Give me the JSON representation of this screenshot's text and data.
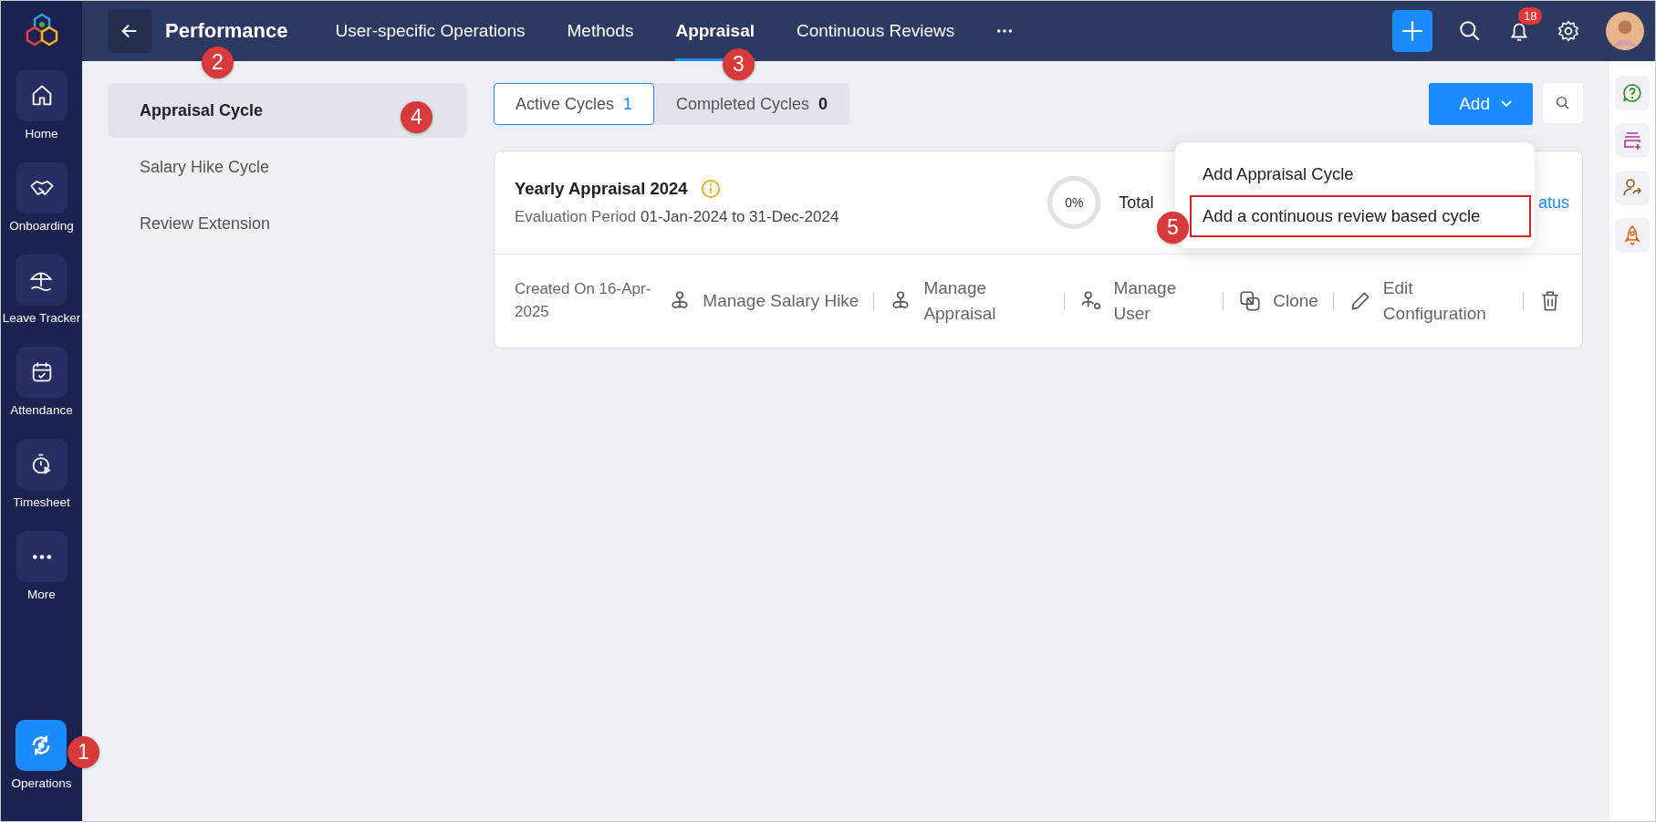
{
  "app_rail": {
    "items": [
      {
        "label": "Home",
        "selected": false
      },
      {
        "label": "Onboarding",
        "selected": false
      },
      {
        "label": "Leave Tracker",
        "selected": false
      },
      {
        "label": "Attendance",
        "selected": false
      },
      {
        "label": "Timesheet",
        "selected": false
      },
      {
        "label": "More",
        "selected": false
      }
    ],
    "bottom_item": {
      "label": "Operations",
      "selected": true
    }
  },
  "top_bar": {
    "title": "Performance",
    "nav": [
      {
        "label": "User-specific Operations",
        "selected": false
      },
      {
        "label": "Methods",
        "selected": false
      },
      {
        "label": "Appraisal",
        "selected": true
      },
      {
        "label": "Continuous Reviews",
        "selected": false
      }
    ],
    "notification_count": "18"
  },
  "sub_sidebar": {
    "items": [
      {
        "label": "Appraisal Cycle",
        "selected": true
      },
      {
        "label": "Salary Hike Cycle",
        "selected": false
      },
      {
        "label": "Review Extension",
        "selected": false
      }
    ]
  },
  "cycle_tabs": [
    {
      "label": "Active Cycles",
      "count": "1",
      "selected": true
    },
    {
      "label": "Completed Cycles",
      "count": "0",
      "selected": false
    }
  ],
  "add_button": {
    "label": "Add"
  },
  "add_menu": {
    "items": [
      {
        "label": "Add Appraisal Cycle",
        "outlined": false
      },
      {
        "label": "Add a continuous review based cycle",
        "outlined": true
      }
    ]
  },
  "card": {
    "title": "Yearly Appraisal 2024",
    "period": "Evaluation Period **01-Jan-2024 to 31-Dec-2024**",
    "progress": {
      "text": "0%",
      "level": 0
    },
    "total_label": "Total",
    "status_link": "atus",
    "created": "Created On 16-Apr-2025",
    "actions": [
      {
        "label": "Manage Salary Hike"
      },
      {
        "label": "Manage Appraisal"
      },
      {
        "label": "Manage User"
      },
      {
        "label": "Clone"
      },
      {
        "label": "Edit Configuration"
      }
    ]
  },
  "callouts": [
    {
      "number": "1"
    },
    {
      "number": "2"
    },
    {
      "number": "3"
    },
    {
      "number": "4"
    },
    {
      "number": "5"
    }
  ]
}
